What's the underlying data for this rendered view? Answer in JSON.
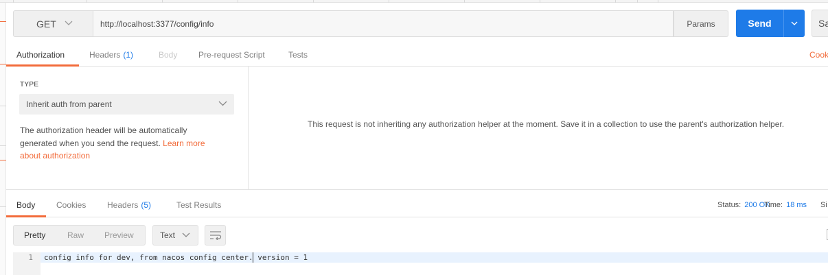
{
  "request": {
    "method": "GET",
    "url": "http://localhost:3377/config/info",
    "params_label": "Params",
    "send_label": "Send",
    "save_label": "Sa"
  },
  "request_tabs": [
    {
      "label": "Authorization"
    },
    {
      "label": "Headers",
      "count": "(1)"
    },
    {
      "label": "Body"
    },
    {
      "label": "Pre-request Script"
    },
    {
      "label": "Tests"
    }
  ],
  "cookies_link": "Cook",
  "auth": {
    "type_label": "TYPE",
    "type_value": "Inherit auth from parent",
    "description": "The authorization header will be automatically generated when you send the request. ",
    "learn_more": "Learn more about authorization",
    "message": "This request is not inheriting any authorization helper at the moment. Save it in a collection to use the parent's authorization helper."
  },
  "response_tabs": [
    {
      "label": "Body"
    },
    {
      "label": "Cookies"
    },
    {
      "label": "Headers",
      "count": "(5)"
    },
    {
      "label": "Test Results"
    }
  ],
  "response_status": {
    "status_label": "Status:",
    "status_value": "200 OK",
    "time_label": "Time:",
    "time_value": "18 ms",
    "size_label": "Si"
  },
  "response_view": {
    "formats": [
      "Pretty",
      "Raw",
      "Preview"
    ],
    "language": "Text"
  },
  "response_body": {
    "line_number": "1",
    "text": "config info for dev, from nacos config center. version = 1"
  },
  "colors": {
    "accent": "#f26b3a",
    "primary": "#1e7be8"
  }
}
